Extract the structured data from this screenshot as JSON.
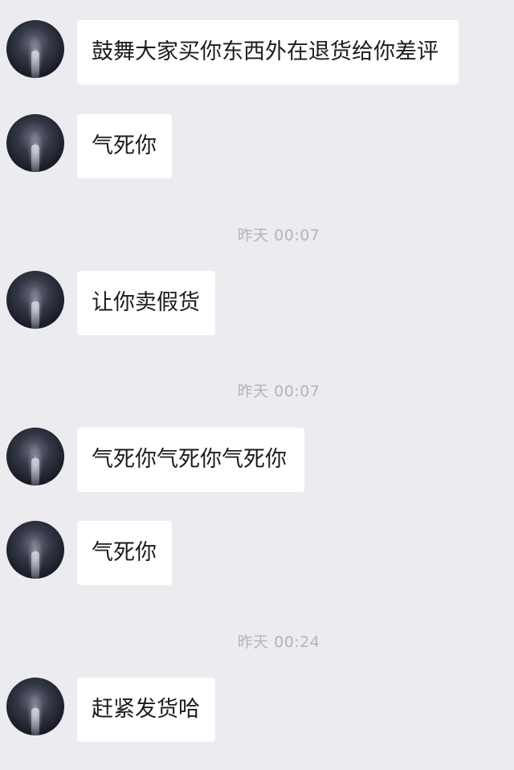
{
  "chat": {
    "messages": [
      {
        "text": "鼓舞大家买你东西外在退货给你差评"
      },
      {
        "text": "气死你"
      },
      {
        "text": "让你卖假货"
      },
      {
        "text": "气死你气死你气死你"
      },
      {
        "text": "气死你"
      },
      {
        "text": "赶紧发货哈"
      }
    ],
    "timestamps": [
      {
        "text": "昨天 00:07"
      },
      {
        "text": "昨天 00:07"
      },
      {
        "text": "昨天 00:24"
      }
    ]
  }
}
